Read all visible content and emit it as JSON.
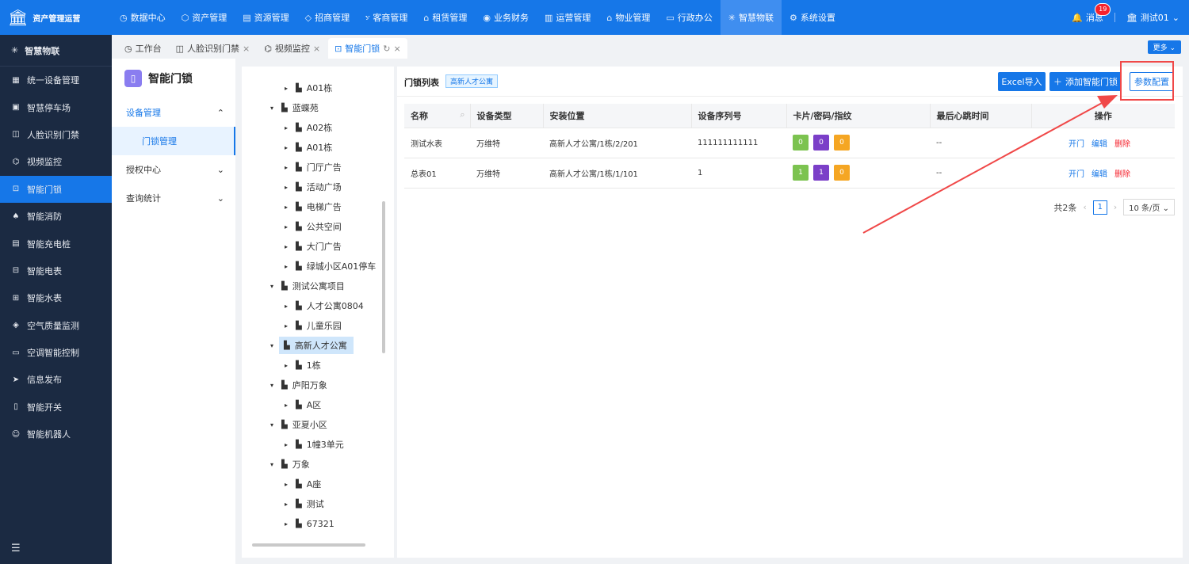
{
  "app": {
    "title": "资产管理运营",
    "logo_icon": "bank-icon"
  },
  "topnav": [
    {
      "label": "数据中心",
      "icon": "clock-icon"
    },
    {
      "label": "资产管理",
      "icon": "cube-icon"
    },
    {
      "label": "资源管理",
      "icon": "doc-icon"
    },
    {
      "label": "招商管理",
      "icon": "tag-icon"
    },
    {
      "label": "客商管理",
      "icon": "users-icon"
    },
    {
      "label": "租赁管理",
      "icon": "home-icon"
    },
    {
      "label": "业务财务",
      "icon": "coin-icon"
    },
    {
      "label": "运营管理",
      "icon": "chart-icon"
    },
    {
      "label": "物业管理",
      "icon": "building-icon"
    },
    {
      "label": "行政办公",
      "icon": "monitor-icon"
    },
    {
      "label": "智慧物联",
      "icon": "atom-icon",
      "active": true
    },
    {
      "label": "系统设置",
      "icon": "gear-icon"
    }
  ],
  "header_right": {
    "message_label": "消息",
    "message_count": "19",
    "user": "测试01"
  },
  "sidebar": {
    "head": "智慧物联",
    "items": [
      {
        "label": "统一设备管理",
        "icon": "grid-icon"
      },
      {
        "label": "智慧停车场",
        "icon": "parking-icon"
      },
      {
        "label": "人脸识别门禁",
        "icon": "face-icon"
      },
      {
        "label": "视频监控",
        "icon": "camera-icon"
      },
      {
        "label": "智能门锁",
        "icon": "lock-icon",
        "active": true
      },
      {
        "label": "智能消防",
        "icon": "fire-icon"
      },
      {
        "label": "智能充电桩",
        "icon": "charger-icon"
      },
      {
        "label": "智能电表",
        "icon": "meter-icon"
      },
      {
        "label": "智能水表",
        "icon": "water-icon"
      },
      {
        "label": "空气质量监测",
        "icon": "air-icon"
      },
      {
        "label": "空调智能控制",
        "icon": "ac-icon"
      },
      {
        "label": "信息发布",
        "icon": "send-icon"
      },
      {
        "label": "智能开关",
        "icon": "switch-icon"
      },
      {
        "label": "智能机器人",
        "icon": "robot-icon"
      }
    ]
  },
  "tabs": [
    {
      "label": "工作台",
      "closable": false
    },
    {
      "label": "人脸识别门禁",
      "closable": true
    },
    {
      "label": "视频监控",
      "closable": true
    },
    {
      "label": "智能门锁",
      "closable": true,
      "active": true
    }
  ],
  "more_label": "更多",
  "left_panel": {
    "title": "智能门锁",
    "menu": [
      {
        "label": "设备管理",
        "open": true,
        "children": [
          "门锁管理"
        ]
      },
      {
        "label": "授权中心",
        "open": false
      },
      {
        "label": "查询统计",
        "open": false
      }
    ]
  },
  "tree": [
    {
      "label": "A01栋",
      "level": 2,
      "expanded": false
    },
    {
      "label": "蓝蝶苑",
      "level": 1,
      "expanded": true
    },
    {
      "label": "A02栋",
      "level": 2,
      "expanded": false
    },
    {
      "label": "A01栋",
      "level": 2,
      "expanded": false
    },
    {
      "label": "门厅广告",
      "level": 2,
      "expanded": false
    },
    {
      "label": "活动广场",
      "level": 2,
      "expanded": false
    },
    {
      "label": "电梯广告",
      "level": 2,
      "expanded": false
    },
    {
      "label": "公共空间",
      "level": 2,
      "expanded": false
    },
    {
      "label": "大门广告",
      "level": 2,
      "expanded": false
    },
    {
      "label": "绿城小区A01停车",
      "level": 2,
      "expanded": false
    },
    {
      "label": "测试公寓项目",
      "level": 1,
      "expanded": true
    },
    {
      "label": "人才公寓0804",
      "level": 2,
      "expanded": false
    },
    {
      "label": "儿童乐园",
      "level": 2,
      "expanded": false
    },
    {
      "label": "高新人才公寓",
      "level": 1,
      "expanded": true,
      "selected": true
    },
    {
      "label": "1栋",
      "level": 2,
      "expanded": false
    },
    {
      "label": "庐阳万象",
      "level": 1,
      "expanded": true
    },
    {
      "label": "A区",
      "level": 2,
      "expanded": false
    },
    {
      "label": "亚夏小区",
      "level": 1,
      "expanded": true
    },
    {
      "label": "1幢3单元",
      "level": 2,
      "expanded": false
    },
    {
      "label": "万象",
      "level": 1,
      "expanded": true
    },
    {
      "label": "A座",
      "level": 2,
      "expanded": false
    },
    {
      "label": "测试",
      "level": 2,
      "expanded": false
    },
    {
      "label": "67321",
      "level": 2,
      "expanded": false
    }
  ],
  "main": {
    "title": "门锁列表",
    "tag": "高新人才公寓",
    "buttons": {
      "excel": "Excel导入",
      "add": "添加智能门锁",
      "config": "参数配置"
    },
    "columns": [
      "名称",
      "设备类型",
      "安装位置",
      "设备序列号",
      "卡片/密码/指纹",
      "最后心跳时间",
      "操作"
    ],
    "rows": [
      {
        "name": "测试水表",
        "type": "万维特",
        "location": "高新人才公寓/1栋/2/201",
        "serial": "111111111111",
        "card": "0",
        "pwd": "0",
        "finger": "0",
        "heartbeat": "--",
        "actions": [
          "开门",
          "编辑",
          "删除"
        ]
      },
      {
        "name": "总表01",
        "type": "万维特",
        "location": "高新人才公寓/1栋/1/101",
        "serial": "1",
        "card": "1",
        "pwd": "1",
        "finger": "0",
        "heartbeat": "--",
        "actions": [
          "开门",
          "编辑",
          "删除"
        ]
      }
    ],
    "pager": {
      "total": "共2条",
      "page": "1",
      "size": "10 条/页"
    }
  },
  "colors": {
    "primary": "#1677e8",
    "sidebar": "#1b2a42",
    "card": "#7cc350",
    "password": "#7b3fc8",
    "fingerprint": "#f5a623",
    "danger": "#f5222d",
    "annotation": "#f04848"
  }
}
